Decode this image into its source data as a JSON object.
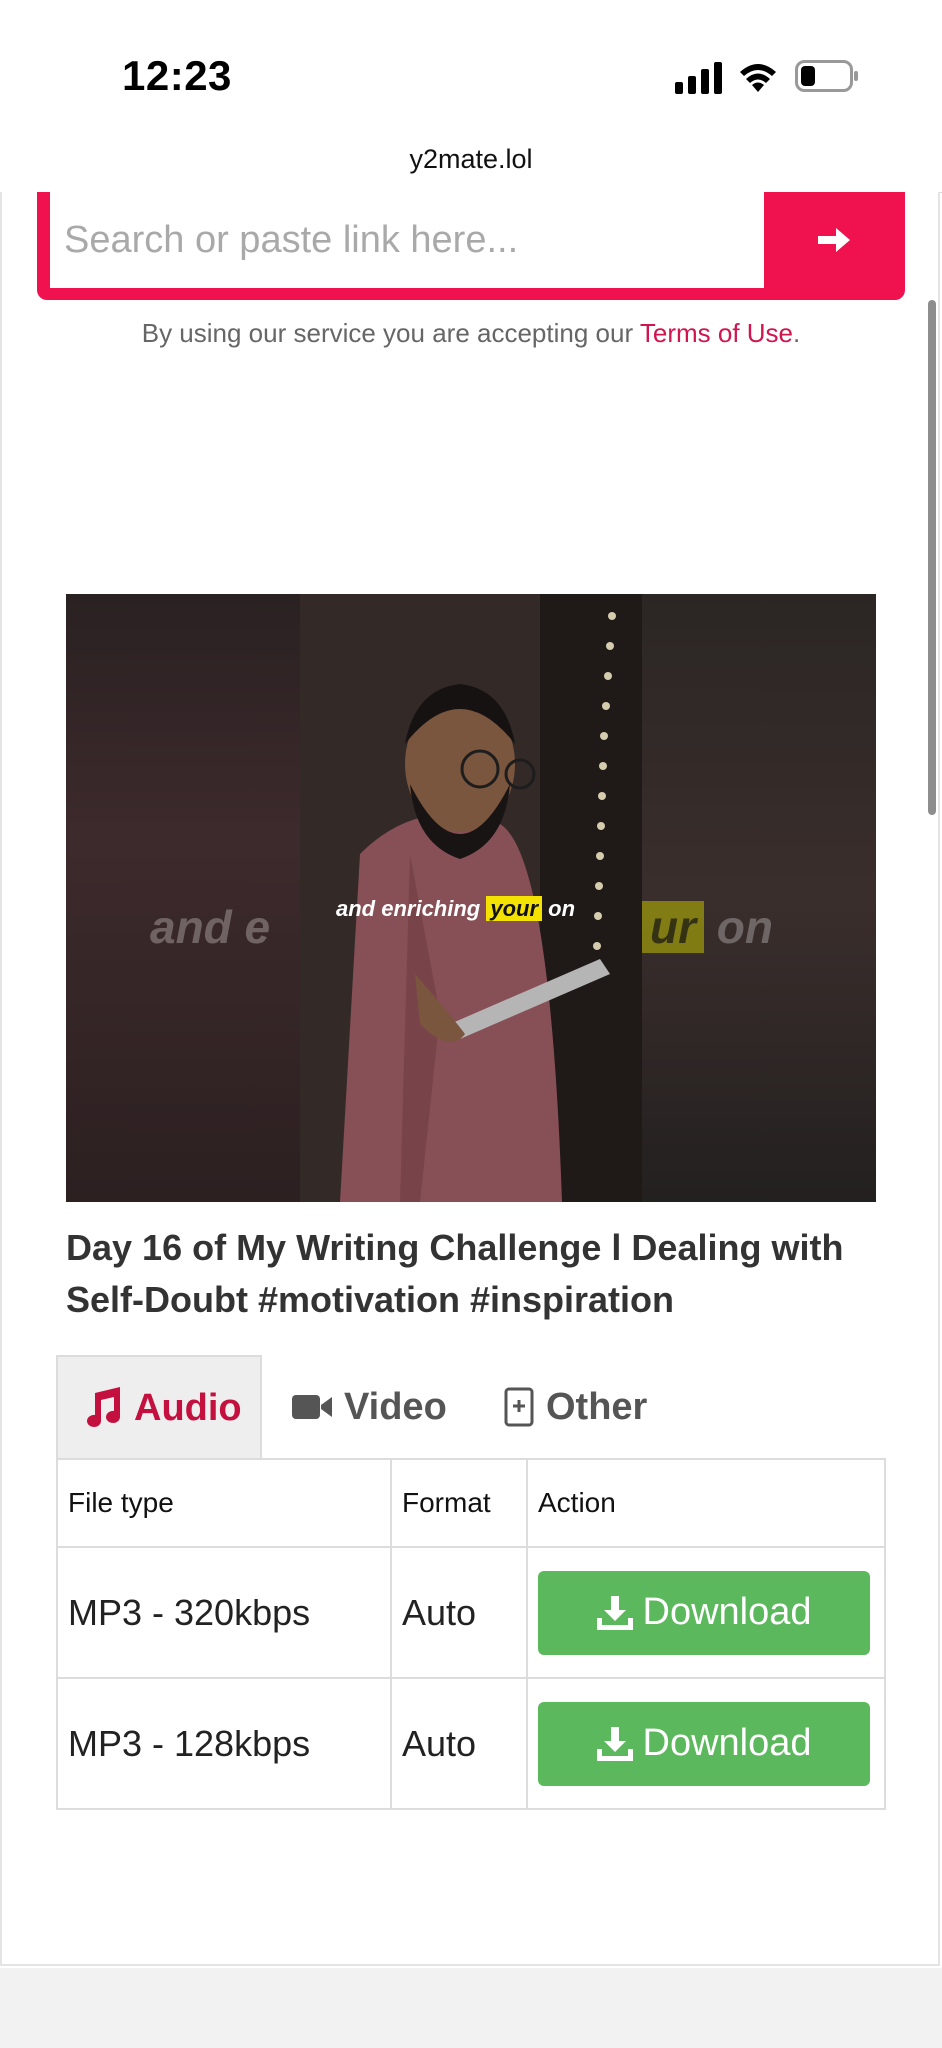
{
  "status_bar": {
    "time": "12:23"
  },
  "browser": {
    "url": "y2mate.lol"
  },
  "search": {
    "placeholder": "Search or paste link here..."
  },
  "terms": {
    "prefix": "By using our service you are accepting our ",
    "link": "Terms of Use",
    "suffix": "."
  },
  "video": {
    "caption": {
      "before": "and enriching ",
      "highlight": "your",
      "after": " on",
      "left_fragment": "and e",
      "right_highlight": "ur",
      "right_after": " on"
    },
    "title": "Day 16 of My Writing Challenge l Dealing with Self-Doubt #motivation #inspiration"
  },
  "tabs": [
    {
      "label": "Audio",
      "icon": "music-icon",
      "active": true
    },
    {
      "label": "Video",
      "icon": "video-camera-icon",
      "active": false
    },
    {
      "label": "Other",
      "icon": "file-plus-icon",
      "active": false
    }
  ],
  "table": {
    "headers": [
      "File type",
      "Format",
      "Action"
    ],
    "rows": [
      {
        "file_type": "MP3 - 320kbps",
        "format": "Auto",
        "action": "Download"
      },
      {
        "file_type": "MP3 - 128kbps",
        "format": "Auto",
        "action": "Download"
      }
    ]
  },
  "colors": {
    "accent": "#f0114f",
    "link": "#d0164f",
    "download": "#5cb85c",
    "active_tab": "#c4103f"
  }
}
